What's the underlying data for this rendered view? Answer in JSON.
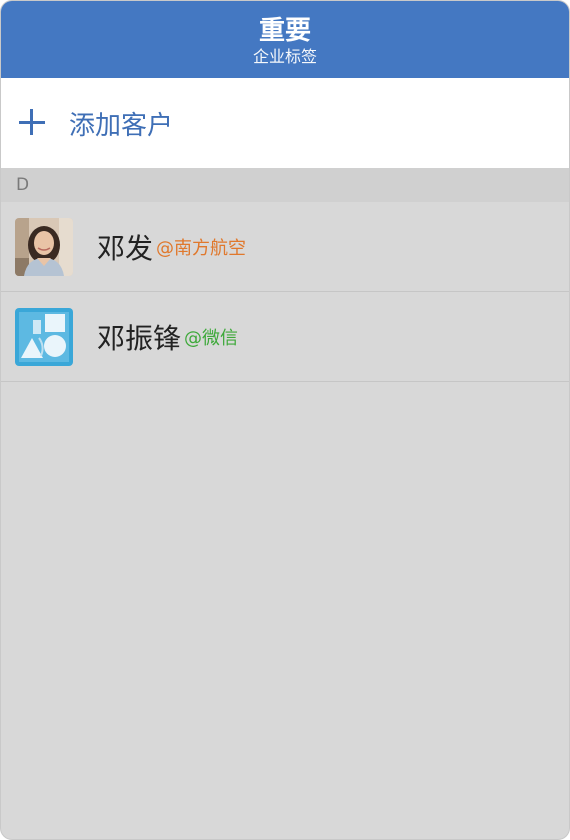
{
  "header": {
    "title": "重要",
    "subtitle": "企业标签"
  },
  "add_customer": {
    "label": "添加客户",
    "icon": "plus-icon",
    "color": "#3f6fb6"
  },
  "section": {
    "letter": "D"
  },
  "contacts": [
    {
      "name": "邓发",
      "org": "@南方航空",
      "org_color": "#e0782c",
      "avatar": "photo-avatar"
    },
    {
      "name": "邓振锋",
      "org": "@微信",
      "org_color": "#3ea93a",
      "avatar": "shapes-avatar"
    }
  ],
  "colors": {
    "header_bg": "#4478c2",
    "list_bg": "#d8d8d8"
  }
}
